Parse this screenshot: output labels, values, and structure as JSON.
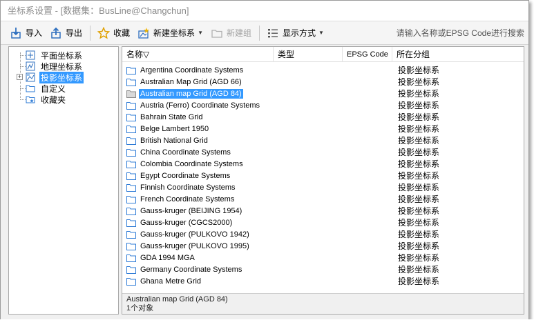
{
  "window": {
    "title": "坐标系设置 - [数据集：BusLine@Changchun]"
  },
  "toolbar": {
    "import_label": "导入",
    "export_label": "导出",
    "favorite_label": "收藏",
    "new_crs_label": "新建坐标系",
    "new_group_label": "新建组",
    "display_mode_label": "显示方式",
    "search_placeholder": "请输入名称或EPSG Code进行搜索"
  },
  "tree": {
    "items": [
      {
        "label": "平面坐标系",
        "icon": "planar-crs-icon"
      },
      {
        "label": "地理坐标系",
        "icon": "geographic-crs-icon"
      },
      {
        "label": "投影坐标系",
        "icon": "projected-crs-icon",
        "selected": true,
        "expander": "+"
      },
      {
        "label": "自定义",
        "icon": "custom-folder-icon"
      },
      {
        "label": "收藏夹",
        "icon": "favorites-folder-icon"
      }
    ]
  },
  "list": {
    "columns": {
      "name": "名称▽",
      "type": "类型",
      "epsg": "EPSG Code",
      "group": "所在分组"
    },
    "rows": [
      {
        "name": "Argentina Coordinate Systems",
        "group": "投影坐标系"
      },
      {
        "name": "Australian Map Grid (AGD 66)",
        "group": "投影坐标系"
      },
      {
        "name": "Australian map Grid (AGD 84)",
        "group": "投影坐标系",
        "selected": true
      },
      {
        "name": "Austria (Ferro) Coordinate Systems",
        "group": "投影坐标系"
      },
      {
        "name": "Bahrain State Grid",
        "group": "投影坐标系"
      },
      {
        "name": "Belge Lambert 1950",
        "group": "投影坐标系"
      },
      {
        "name": "British National Grid",
        "group": "投影坐标系"
      },
      {
        "name": "China Coordinate Systems",
        "group": "投影坐标系"
      },
      {
        "name": "Colombia Coordinate Systems",
        "group": "投影坐标系"
      },
      {
        "name": "Egypt Coordinate Systems",
        "group": "投影坐标系"
      },
      {
        "name": "Finnish Coordinate Systems",
        "group": "投影坐标系"
      },
      {
        "name": "French Coordinate Systems",
        "group": "投影坐标系"
      },
      {
        "name": "Gauss-kruger (BEIJING 1954)",
        "group": "投影坐标系"
      },
      {
        "name": "Gauss-kruger (CGCS2000)",
        "group": "投影坐标系"
      },
      {
        "name": "Gauss-kruger (PULKOVO 1942)",
        "group": "投影坐标系"
      },
      {
        "name": "Gauss-kruger (PULKOVO 1995)",
        "group": "投影坐标系"
      },
      {
        "name": "GDA 1994 MGA",
        "group": "投影坐标系"
      },
      {
        "name": "Germany Coordinate Systems",
        "group": "投影坐标系"
      },
      {
        "name": "Ghana Metre Grid",
        "group": "投影坐标系"
      }
    ]
  },
  "status": {
    "selected_name": "Australian map Grid (AGD 84)",
    "count_text": "1个对象"
  },
  "colors": {
    "selection": "#3399ff",
    "folder": "#2e7bd6"
  }
}
